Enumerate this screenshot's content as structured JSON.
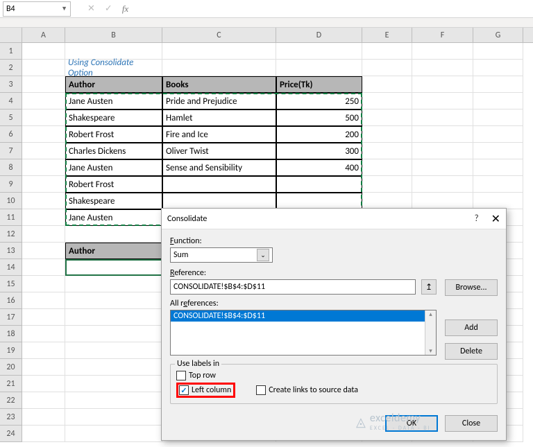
{
  "namebox": {
    "value": "B4"
  },
  "columns": [
    "A",
    "B",
    "C",
    "D",
    "E",
    "F",
    "G"
  ],
  "rows": [
    "1",
    "2",
    "3",
    "4",
    "5",
    "6",
    "7",
    "8",
    "9",
    "10",
    "11",
    "12",
    "13",
    "14",
    "15",
    "16",
    "17",
    "18",
    "19",
    "20",
    "21",
    "22",
    "23",
    "24"
  ],
  "title": "Using Consolidate Option",
  "headers": {
    "author": "Author",
    "books": "Books",
    "price": "Price(Tk)"
  },
  "data_rows": [
    {
      "author": "Jane Austen",
      "book": "Pride and Prejudice",
      "price": "250"
    },
    {
      "author": "Shakespeare",
      "book": "Hamlet",
      "price": "500"
    },
    {
      "author": "Robert Frost",
      "book": "Fire and Ice",
      "price": "200"
    },
    {
      "author": "Charles Dickens",
      "book": "Oliver Twist",
      "price": "300"
    },
    {
      "author": "Jane Austen",
      "book": "Sense and Sensibility",
      "price": "400"
    },
    {
      "author": "Robert Frost",
      "book": "",
      "price": ""
    },
    {
      "author": "Shakespeare",
      "book": "",
      "price": ""
    },
    {
      "author": "Jane Austen",
      "book": "",
      "price": ""
    }
  ],
  "summary_header": "Author",
  "dialog": {
    "title": "Consolidate",
    "function_label": "Function:",
    "function_value": "Sum",
    "reference_label": "Reference:",
    "reference_value": "CONSOLIDATE!$B$4:$D$11",
    "allrefs_label": "All references:",
    "allrefs_item": "CONSOLIDATE!$B$4:$D$11",
    "browse": "Browse...",
    "add": "Add",
    "delete": "Delete",
    "use_labels": "Use labels in",
    "top_row": "Top row",
    "left_column": "Left column",
    "create_links": "Create links to source data",
    "ok": "OK",
    "close": "Close"
  },
  "watermark": {
    "brand": "exceldemy",
    "sub": "EXCEL · DATA · BI"
  }
}
